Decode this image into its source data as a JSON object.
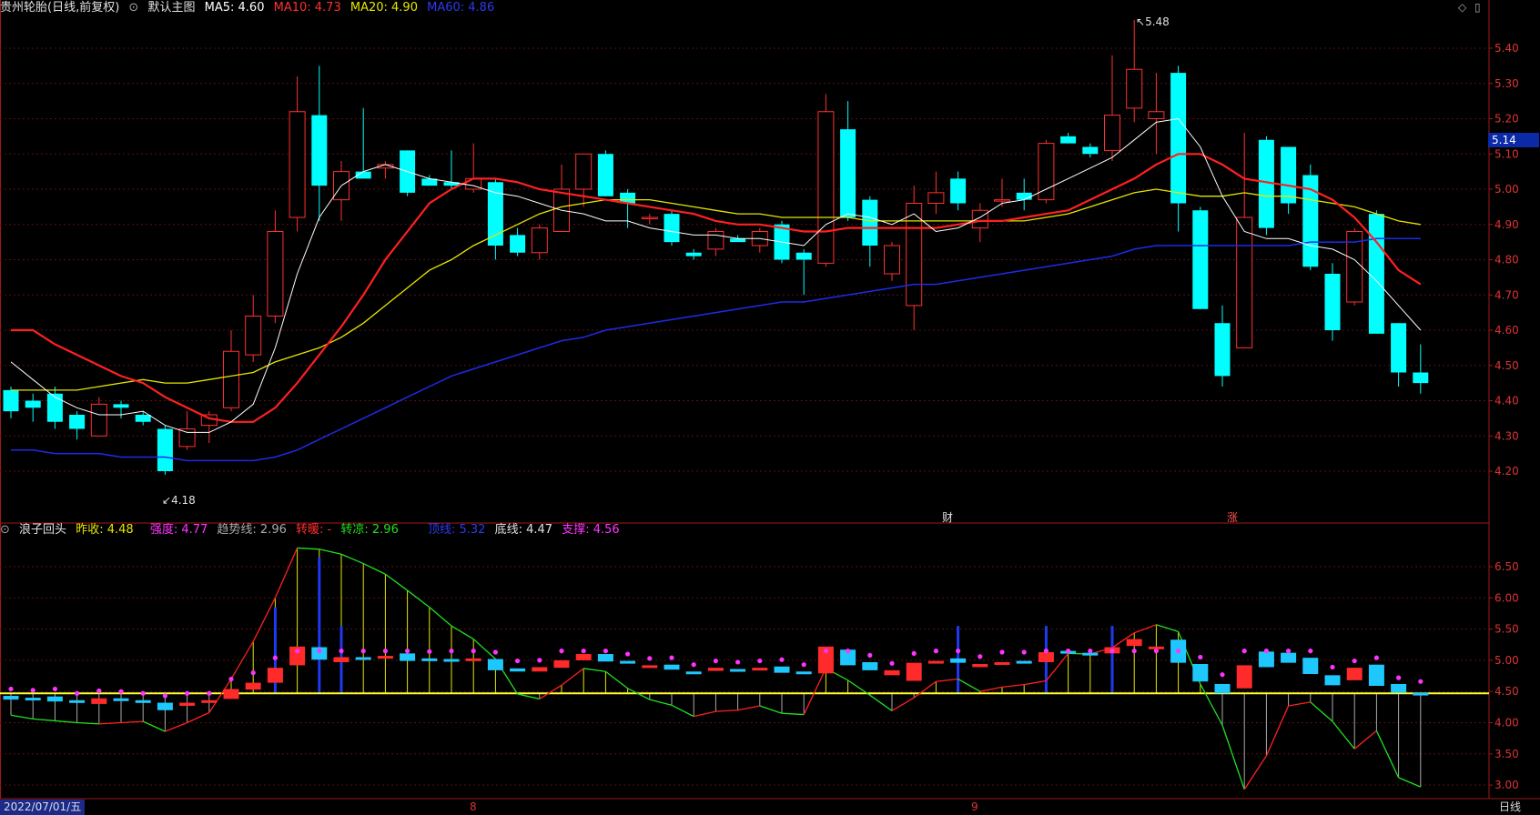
{
  "main_header": {
    "title": "贵州轮胎(日线,前复权)",
    "layout": "默认主图",
    "ma5": "MA5: 4.60",
    "ma10": "MA10: 4.73",
    "ma20": "MA20: 4.90",
    "ma60": "MA60: 4.86"
  },
  "sub_header": {
    "name": "浪子回头",
    "prev_close": "昨收: 4.48",
    "strength": "强度: 4.77",
    "trend": "趋势线: 2.96",
    "warm": "转暖: -",
    "cool": "转凉: 2.96",
    "top": "顶线: 5.32",
    "bottom": "底线: 4.47",
    "support": "支撑: 4.56"
  },
  "price_badge": "5.14",
  "labels": {
    "high": "5.48",
    "low": "4.18",
    "event1": "财",
    "event2": "涨"
  },
  "bottom": {
    "date": "2022/07/01/五",
    "m8": "8",
    "m9": "9",
    "period": "日线"
  },
  "colors": {
    "up": "#ff3030",
    "down": "#00ffff",
    "ma5": "#ffffff",
    "ma10": "#ff2020",
    "ma20": "#e6e600",
    "ma60": "#1e2be8"
  },
  "chart_data": {
    "type": "candlestick",
    "main_yaxis": [
      "5.40",
      "5.30",
      "5.20",
      "5.10",
      "5.00",
      "4.90",
      "4.80",
      "4.70",
      "4.60",
      "4.50",
      "4.40",
      "4.30",
      "4.20"
    ],
    "sub_yaxis": [
      "6.50",
      "6.00",
      "5.50",
      "5.00",
      "4.50",
      "4.00",
      "3.50",
      "3.00"
    ],
    "candles": [
      [
        4.43,
        4.44,
        4.35,
        4.37
      ],
      [
        4.4,
        4.42,
        4.34,
        4.38
      ],
      [
        4.42,
        4.44,
        4.32,
        4.34
      ],
      [
        4.36,
        4.37,
        4.29,
        4.32
      ],
      [
        4.3,
        4.41,
        4.3,
        4.39
      ],
      [
        4.39,
        4.4,
        4.35,
        4.38
      ],
      [
        4.36,
        4.37,
        4.33,
        4.34
      ],
      [
        4.32,
        4.33,
        4.19,
        4.2
      ],
      [
        4.27,
        4.37,
        4.26,
        4.32
      ],
      [
        4.33,
        4.37,
        4.28,
        4.36
      ],
      [
        4.38,
        4.6,
        4.37,
        4.54
      ],
      [
        4.53,
        4.7,
        4.51,
        4.64
      ],
      [
        4.64,
        4.94,
        4.62,
        4.88
      ],
      [
        4.92,
        5.32,
        4.88,
        5.22
      ],
      [
        5.21,
        5.35,
        4.91,
        5.01
      ],
      [
        4.97,
        5.08,
        4.91,
        5.05
      ],
      [
        5.05,
        5.23,
        5.03,
        5.03
      ],
      [
        5.06,
        5.08,
        5.03,
        5.07
      ],
      [
        5.11,
        5.11,
        4.98,
        4.99
      ],
      [
        5.03,
        5.04,
        5.01,
        5.01
      ],
      [
        5.02,
        5.11,
        5.0,
        5.01
      ],
      [
        5.0,
        5.13,
        4.99,
        5.03
      ],
      [
        5.02,
        5.03,
        4.8,
        4.84
      ],
      [
        4.87,
        4.89,
        4.81,
        4.82
      ],
      [
        4.82,
        4.9,
        4.8,
        4.89
      ],
      [
        4.88,
        5.07,
        4.88,
        5.0
      ],
      [
        5.0,
        5.09,
        4.95,
        5.1
      ],
      [
        5.1,
        5.11,
        4.98,
        4.98
      ],
      [
        4.99,
        5.0,
        4.89,
        4.96
      ],
      [
        4.92,
        4.93,
        4.9,
        4.92
      ],
      [
        4.93,
        4.94,
        4.84,
        4.85
      ],
      [
        4.82,
        4.83,
        4.8,
        4.81
      ],
      [
        4.83,
        4.89,
        4.81,
        4.88
      ],
      [
        4.86,
        4.87,
        4.85,
        4.85
      ],
      [
        4.84,
        4.89,
        4.82,
        4.88
      ],
      [
        4.9,
        4.91,
        4.79,
        4.8
      ],
      [
        4.82,
        4.83,
        4.7,
        4.8
      ],
      [
        4.79,
        5.27,
        4.78,
        5.22
      ],
      [
        5.17,
        5.25,
        4.91,
        4.92
      ],
      [
        4.97,
        4.98,
        4.78,
        4.84
      ],
      [
        4.76,
        4.85,
        4.74,
        4.84
      ],
      [
        4.67,
        5.01,
        4.6,
        4.96
      ],
      [
        4.96,
        5.05,
        4.93,
        4.99
      ],
      [
        5.03,
        5.05,
        4.94,
        4.96
      ],
      [
        4.89,
        4.96,
        4.85,
        4.94
      ],
      [
        4.97,
        5.03,
        4.95,
        4.97
      ],
      [
        4.99,
        5.03,
        4.94,
        4.97
      ],
      [
        4.97,
        5.14,
        4.96,
        5.13
      ],
      [
        5.15,
        5.16,
        5.13,
        5.13
      ],
      [
        5.12,
        5.13,
        5.09,
        5.1
      ],
      [
        5.11,
        5.38,
        5.08,
        5.21
      ],
      [
        5.23,
        5.48,
        5.19,
        5.34
      ],
      [
        5.2,
        5.33,
        5.1,
        5.22
      ],
      [
        5.33,
        5.35,
        4.88,
        4.96
      ],
      [
        4.94,
        4.95,
        4.66,
        4.66
      ],
      [
        4.62,
        4.67,
        4.44,
        4.47
      ],
      [
        4.55,
        5.16,
        4.55,
        4.92
      ],
      [
        5.14,
        5.15,
        4.87,
        4.89
      ],
      [
        5.12,
        5.12,
        4.93,
        4.96
      ],
      [
        5.04,
        5.07,
        4.77,
        4.78
      ],
      [
        4.76,
        4.79,
        4.57,
        4.6
      ],
      [
        4.68,
        4.89,
        4.67,
        4.88
      ],
      [
        4.93,
        4.94,
        4.59,
        4.59
      ],
      [
        4.62,
        4.62,
        4.44,
        4.48
      ],
      [
        4.48,
        4.56,
        4.42,
        4.45
      ]
    ],
    "ma5": [
      4.51,
      4.46,
      4.41,
      4.38,
      4.36,
      4.36,
      4.37,
      4.33,
      4.31,
      4.31,
      4.34,
      4.39,
      4.55,
      4.76,
      4.92,
      5.01,
      5.05,
      5.07,
      5.05,
      5.03,
      5.02,
      5.01,
      4.99,
      4.98,
      4.96,
      4.94,
      4.93,
      4.91,
      4.91,
      4.89,
      4.88,
      4.87,
      4.87,
      4.86,
      4.86,
      4.85,
      4.84,
      4.9,
      4.93,
      4.92,
      4.9,
      4.93,
      4.88,
      4.89,
      4.92,
      4.96,
      4.97,
      5.0,
      5.03,
      5.06,
      5.09,
      5.14,
      5.19,
      5.2,
      5.12,
      4.98,
      4.88,
      4.86,
      4.86,
      4.84,
      4.83,
      4.8,
      4.74,
      4.67,
      4.6
    ],
    "ma10": [
      4.6,
      4.6,
      4.56,
      4.53,
      4.5,
      4.47,
      4.45,
      4.41,
      4.38,
      4.35,
      4.34,
      4.34,
      4.38,
      4.45,
      4.53,
      4.61,
      4.7,
      4.8,
      4.88,
      4.96,
      5.0,
      5.03,
      5.03,
      5.02,
      5.0,
      4.99,
      4.98,
      4.97,
      4.96,
      4.95,
      4.94,
      4.93,
      4.91,
      4.9,
      4.9,
      4.89,
      4.88,
      4.88,
      4.89,
      4.89,
      4.89,
      4.89,
      4.89,
      4.9,
      4.91,
      4.91,
      4.92,
      4.93,
      4.94,
      4.97,
      5.0,
      5.03,
      5.07,
      5.1,
      5.1,
      5.07,
      5.03,
      5.02,
      5.01,
      5.0,
      4.97,
      4.92,
      4.85,
      4.77,
      4.73
    ],
    "ma20": [
      4.43,
      4.43,
      4.43,
      4.43,
      4.44,
      4.45,
      4.46,
      4.45,
      4.45,
      4.46,
      4.47,
      4.48,
      4.51,
      4.53,
      4.55,
      4.58,
      4.62,
      4.67,
      4.72,
      4.77,
      4.8,
      4.84,
      4.87,
      4.9,
      4.93,
      4.95,
      4.96,
      4.97,
      4.97,
      4.97,
      4.96,
      4.95,
      4.94,
      4.93,
      4.93,
      4.92,
      4.92,
      4.92,
      4.92,
      4.91,
      4.91,
      4.91,
      4.91,
      4.91,
      4.91,
      4.91,
      4.91,
      4.92,
      4.93,
      4.95,
      4.97,
      4.99,
      5.0,
      4.99,
      4.98,
      4.98,
      4.99,
      4.98,
      4.98,
      4.97,
      4.96,
      4.95,
      4.93,
      4.91,
      4.9
    ],
    "ma60": [
      4.26,
      4.26,
      4.25,
      4.25,
      4.25,
      4.24,
      4.24,
      4.24,
      4.23,
      4.23,
      4.23,
      4.23,
      4.24,
      4.26,
      4.29,
      4.32,
      4.35,
      4.38,
      4.41,
      4.44,
      4.47,
      4.49,
      4.51,
      4.53,
      4.55,
      4.57,
      4.58,
      4.6,
      4.61,
      4.62,
      4.63,
      4.64,
      4.65,
      4.66,
      4.67,
      4.68,
      4.68,
      4.69,
      4.7,
      4.71,
      4.72,
      4.73,
      4.73,
      4.74,
      4.75,
      4.76,
      4.77,
      4.78,
      4.79,
      4.8,
      4.81,
      4.83,
      4.84,
      4.84,
      4.84,
      4.84,
      4.84,
      4.84,
      4.84,
      4.85,
      4.85,
      4.85,
      4.86,
      4.86,
      4.86
    ],
    "trend": [
      4.12,
      4.06,
      4.03,
      4.0,
      3.98,
      4.0,
      4.02,
      3.86,
      4.0,
      4.16,
      4.7,
      5.3,
      6.0,
      6.8,
      6.78,
      6.7,
      6.55,
      6.38,
      6.12,
      5.85,
      5.55,
      5.34,
      5.02,
      4.46,
      4.38,
      4.6,
      4.87,
      4.82,
      4.55,
      4.37,
      4.28,
      4.1,
      4.18,
      4.2,
      4.27,
      4.15,
      4.13,
      4.87,
      4.68,
      4.44,
      4.19,
      4.4,
      4.66,
      4.7,
      4.5,
      4.57,
      4.61,
      4.67,
      5.11,
      5.1,
      5.2,
      5.44,
      5.57,
      5.46,
      4.62,
      3.96,
      2.93,
      3.47,
      4.27,
      4.33,
      4.02,
      3.58,
      3.87,
      3.12,
      2.97
    ]
  }
}
